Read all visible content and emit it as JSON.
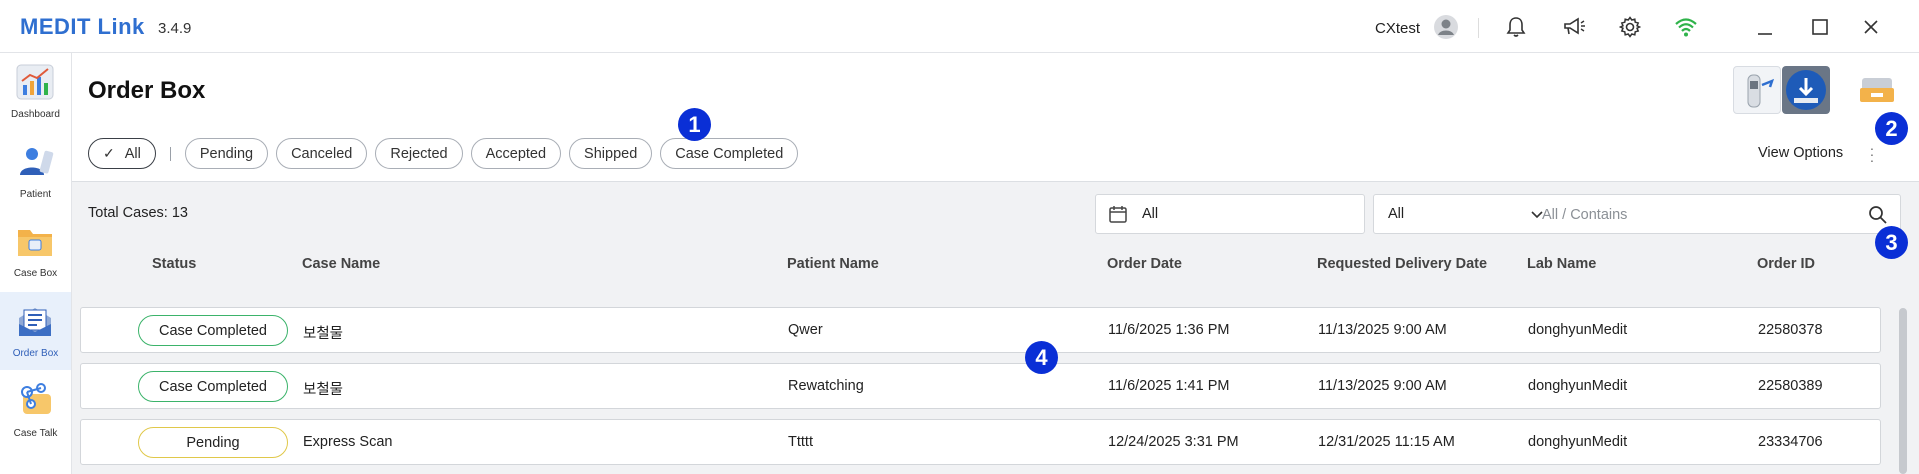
{
  "app": {
    "name": "MEDIT Link",
    "version": "3.4.9",
    "user": "CXtest"
  },
  "sidebar": {
    "items": [
      {
        "label": "Dashboard",
        "icon": "chart-icon"
      },
      {
        "label": "Patient",
        "icon": "patient-icon"
      },
      {
        "label": "Case Box",
        "icon": "folder-icon"
      },
      {
        "label": "Order Box",
        "icon": "order-box-icon",
        "active": true
      },
      {
        "label": "Case Talk",
        "icon": "chat-icon"
      }
    ]
  },
  "page": {
    "title": "Order Box",
    "view_options": "View Options"
  },
  "filters": [
    "All",
    "Pending",
    "Canceled",
    "Rejected",
    "Accepted",
    "Shipped",
    "Case Completed"
  ],
  "badges": [
    "1",
    "2",
    "3",
    "4"
  ],
  "toolbar": {
    "total": "Total Cases: 13",
    "date_filter": "All",
    "search_field": "All",
    "search_placeholder": "All / Contains"
  },
  "table": {
    "columns": [
      "Status",
      "Case Name",
      "Patient Name",
      "Order Date",
      "Requested Delivery Date",
      "Lab Name",
      "Order ID"
    ],
    "rows": [
      {
        "status": "Case Completed",
        "case_name": "보철물",
        "patient": "Qwer",
        "order_date": "11/6/2025 1:36 PM",
        "delivery": "11/13/2025 9:00 AM",
        "lab": "donghyunMedit",
        "order_id": "22580378"
      },
      {
        "status": "Case Completed",
        "case_name": "보철물",
        "patient": "Rewatching",
        "order_date": "11/6/2025 1:41 PM",
        "delivery": "11/13/2025 9:00 AM",
        "lab": "donghyunMedit",
        "order_id": "22580389"
      },
      {
        "status": "Pending",
        "case_name": "Express Scan",
        "patient": "Ttttt",
        "order_date": "12/24/2025 3:31 PM",
        "delivery": "12/31/2025 11:15 AM",
        "lab": "donghyunMedit",
        "order_id": "23334706"
      }
    ]
  },
  "colors": {
    "brand": "#2f6fd0",
    "badge": "#0a2fd6",
    "completed": "#3bb36a",
    "pending": "#e0c84a"
  }
}
